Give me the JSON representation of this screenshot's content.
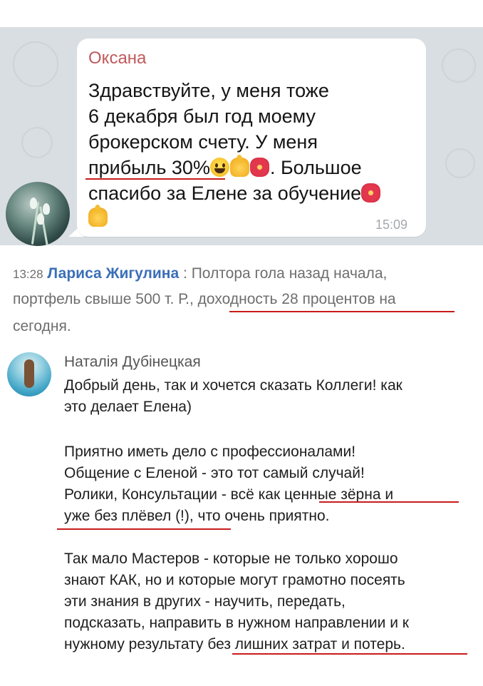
{
  "telegram_message": {
    "sender": "Оксана",
    "lines": [
      "Здравствуйте, у меня тоже",
      "6 декабря был год моему",
      "брокерском счету. У меня",
      "прибыль 30%",
      ". Большое",
      "спасибо за Елене за обучение"
    ],
    "time": "15:09",
    "emoji_names": [
      "grinning-face-icon",
      "thumbs-up-icon",
      "hibiscus-icon"
    ]
  },
  "comment_larisa": {
    "time": "13:28",
    "author": "Лариса Жигулина",
    "separator": " : ",
    "line1": "Полтора гола назад начала,",
    "line2_a": "портфель свыше 500 т. Р., ",
    "line2_b": "доходность 28 процентов",
    "line2_c": " на",
    "line3": "сегодня."
  },
  "comment_natalia": {
    "author": "Наталія Дубінецкая",
    "paragraph1": [
      "Добрый день, так и хочется сказать Коллеги! как",
      "это делает Елена)"
    ],
    "paragraph2": [
      "Приятно иметь дело с профессионалами!",
      "Общение с Еленой - это тот самый случай!",
      "Ролики, Консультации - всё как ценные зёрна и",
      "уже без плёвел (!), что очень приятно."
    ],
    "paragraph3": [
      "Так мало Мастеров - которые не только хорошо",
      "знают КАК, но и которые могут грамотно посеять",
      "эти знания в других - научить, передать,",
      "подсказать, направить в нужном направлении и к",
      "нужному результату без лишних затрат и потерь."
    ]
  },
  "colors": {
    "underline": "#c91c1c",
    "telegram_bg": "#d9dee2",
    "sender_name": "#c0595b",
    "author_link": "#3a6fb7"
  }
}
